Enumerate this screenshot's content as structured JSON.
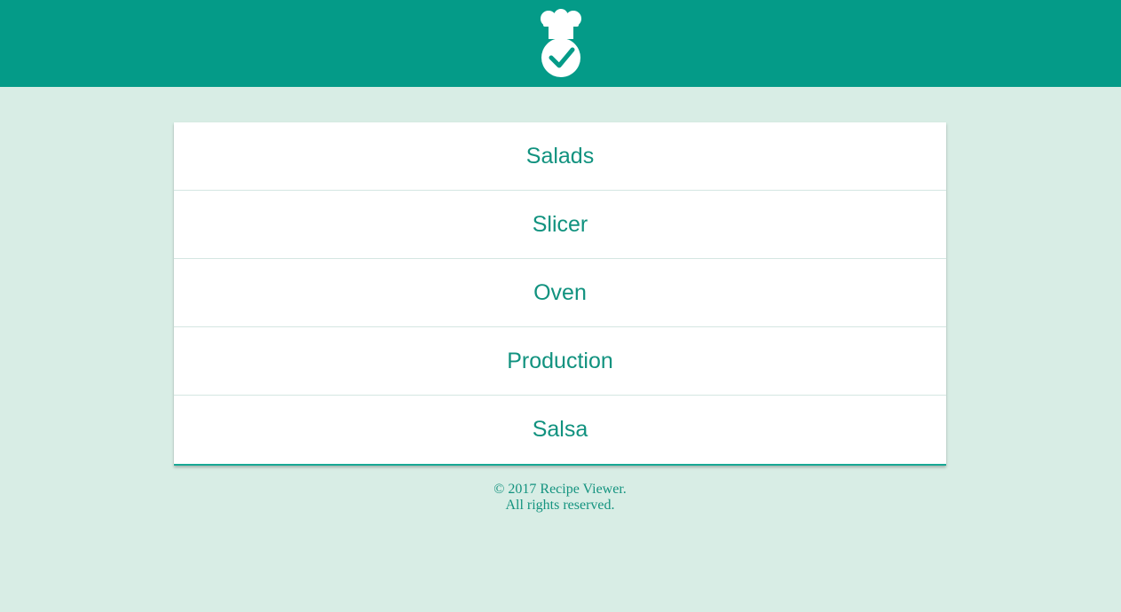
{
  "header": {
    "logo_icon": "chef-hat-check-icon",
    "background_color": "#049b88"
  },
  "menu": {
    "items": [
      {
        "label": "Salads"
      },
      {
        "label": "Slicer"
      },
      {
        "label": "Oven"
      },
      {
        "label": "Production"
      },
      {
        "label": "Salsa"
      }
    ],
    "text_color": "#11927f"
  },
  "footer": {
    "line1": "© 2017 Recipe Viewer.",
    "line2": "All rights reserved."
  },
  "page": {
    "background_color": "#d8ede5"
  }
}
